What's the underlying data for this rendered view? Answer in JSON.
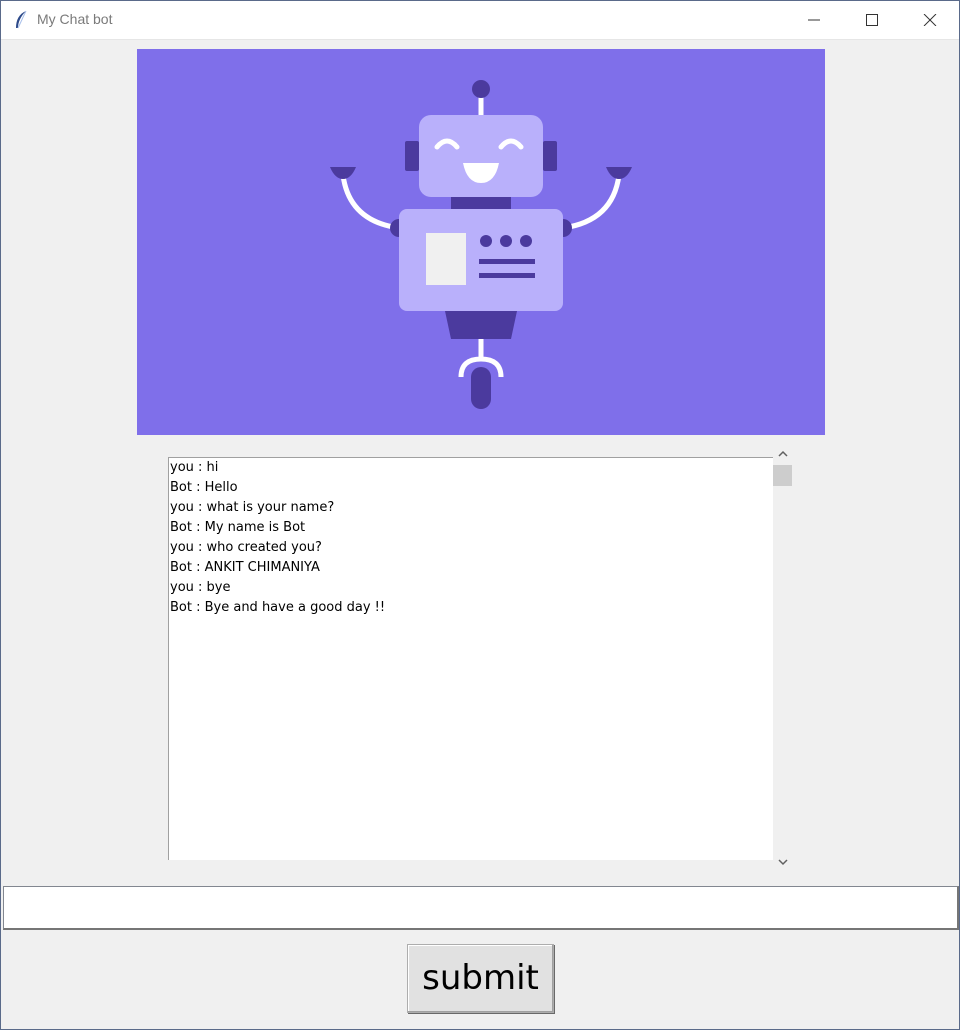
{
  "window": {
    "title": "My Chat bot",
    "title_icon": "feather-icon",
    "controls": [
      "minimize-icon",
      "maximize-icon",
      "close-icon"
    ]
  },
  "banner": {
    "image": "robot-illustration",
    "background_color": "#7f6fea"
  },
  "chat": {
    "lines": [
      "you : hi",
      "Bot : Hello",
      "you : what is your name?",
      "Bot : My name is Bot",
      "you : who created you?",
      "Bot : ANKIT CHIMANIYA",
      "you : bye",
      "Bot : Bye and have a good day !!"
    ]
  },
  "input": {
    "value": "",
    "placeholder": ""
  },
  "actions": {
    "submit_label": "submit"
  }
}
